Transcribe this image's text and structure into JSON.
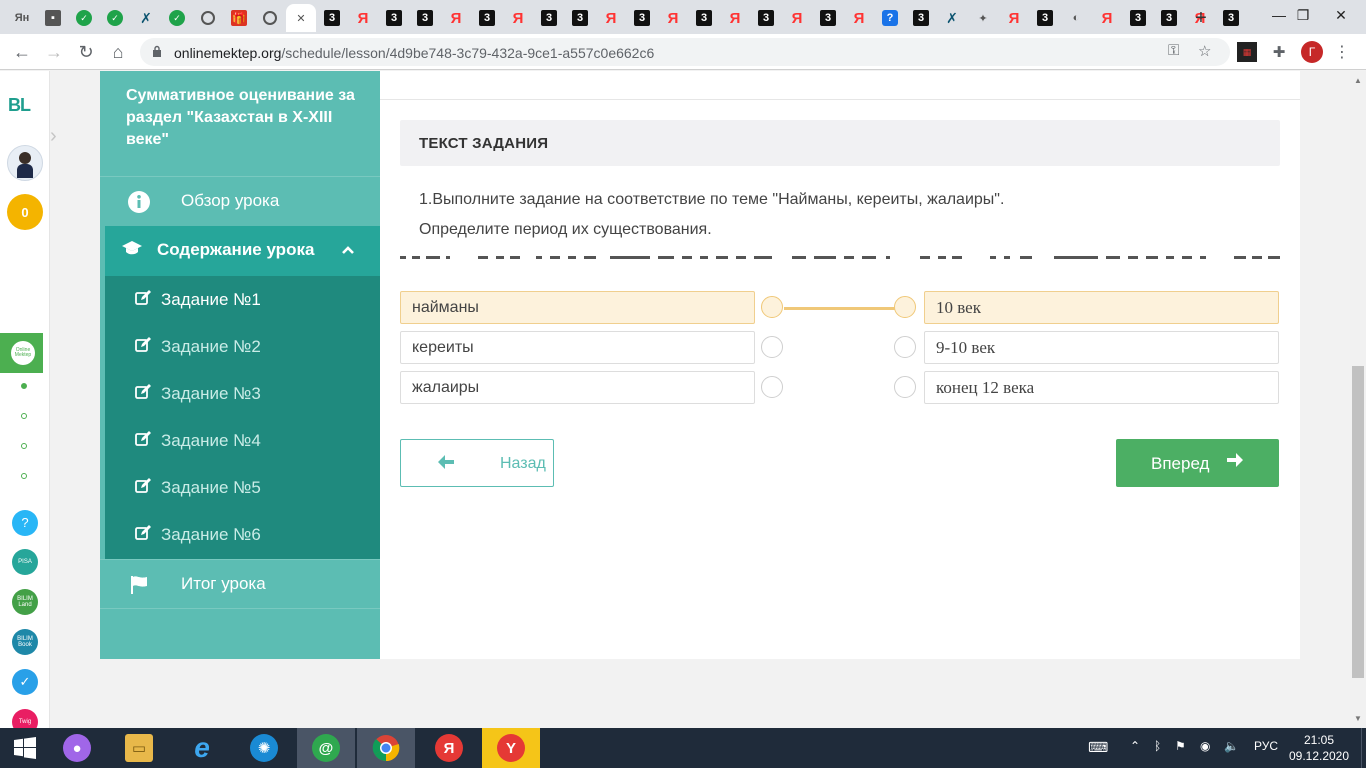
{
  "browser": {
    "tabs": [
      {
        "icon": "yandex-text-icon",
        "text": "Ян"
      },
      {
        "icon": "doc-icon",
        "text": "▪"
      },
      {
        "icon": "shield-icon",
        "text": "✓"
      },
      {
        "icon": "shield-icon",
        "text": "✓"
      },
      {
        "icon": "xx-icon",
        "text": "✗"
      },
      {
        "icon": "shield-icon",
        "text": "✓"
      },
      {
        "icon": "globe-icon",
        "text": ""
      },
      {
        "icon": "gift-icon",
        "text": "🎁"
      },
      {
        "icon": "globe-icon",
        "text": ""
      },
      {
        "icon": "close-icon",
        "text": "✕",
        "active": true
      },
      {
        "icon": "three-icon",
        "text": "3"
      },
      {
        "icon": "yandex-icon",
        "text": "Я"
      },
      {
        "icon": "three-icon",
        "text": "3"
      },
      {
        "icon": "three-icon",
        "text": "3"
      },
      {
        "icon": "yandex-icon",
        "text": "Я"
      },
      {
        "icon": "three-icon",
        "text": "3"
      },
      {
        "icon": "yandex-icon",
        "text": "Я"
      },
      {
        "icon": "three-icon",
        "text": "3"
      },
      {
        "icon": "three-icon",
        "text": "3"
      },
      {
        "icon": "yandex-icon",
        "text": "Я"
      },
      {
        "icon": "three-icon",
        "text": "3"
      },
      {
        "icon": "yandex-icon",
        "text": "Я"
      },
      {
        "icon": "three-icon",
        "text": "3"
      },
      {
        "icon": "yandex-icon",
        "text": "Я"
      },
      {
        "icon": "three-icon",
        "text": "3"
      },
      {
        "icon": "yandex-icon",
        "text": "Я"
      },
      {
        "icon": "three-icon",
        "text": "3"
      },
      {
        "icon": "yandex-icon",
        "text": "Я"
      },
      {
        "icon": "question-icon",
        "text": "?"
      },
      {
        "icon": "three-icon",
        "text": "3"
      },
      {
        "icon": "xx-icon",
        "text": "✗"
      },
      {
        "icon": "lightbulb-icon",
        "text": "✦"
      },
      {
        "icon": "yandex-icon",
        "text": "Я"
      },
      {
        "icon": "three-icon",
        "text": "3"
      },
      {
        "icon": "ball-icon",
        "text": "◐"
      },
      {
        "icon": "yandex-icon",
        "text": "Я"
      },
      {
        "icon": "three-icon",
        "text": "3"
      },
      {
        "icon": "three-icon",
        "text": "3"
      },
      {
        "icon": "yandex-icon",
        "text": "Я"
      },
      {
        "icon": "three-icon",
        "text": "3"
      }
    ],
    "new_tab": "+",
    "window_controls": {
      "minimize": "—",
      "maximize": "❐",
      "close": "✕"
    },
    "url_host": "onlinemektep.org",
    "url_path": "/schedule/lesson/4d9be748-3c79-432a-9ce1-a557c0e662c6",
    "profile_letter": "Г"
  },
  "rail": {
    "logo": "BL",
    "coins": "0",
    "active_app": "Online Mektep",
    "apps": [
      {
        "name": "help-icon",
        "text": "?",
        "color": "#29b6f6"
      },
      {
        "name": "pisa-icon",
        "text": "PISA",
        "color": "#26a69a"
      },
      {
        "name": "bilimland-icon",
        "text": "BILIM Land",
        "color": "#43a047"
      },
      {
        "name": "bilimbook-icon",
        "text": "BILIM Book",
        "color": "#1e88a8"
      },
      {
        "name": "test-icon",
        "text": "✓",
        "color": "#29a0e8"
      },
      {
        "name": "twig-icon",
        "text": "Twig",
        "color": "#e91e63"
      }
    ]
  },
  "sidebar": {
    "title": "Суммативное оценивание за раздел \"Казахстан в X-XIII веке\"",
    "overview": "Обзор урока",
    "content_header": "Содержание урока",
    "tasks": [
      "Задание №1",
      "Задание №2",
      "Задание №3",
      "Задание №4",
      "Задание №5",
      "Задание №6"
    ],
    "summary": "Итог урока"
  },
  "task": {
    "header": "ТЕКСТ ЗАДАНИЯ",
    "line1": "1.Выполните задание на соответствие по теме \"Найманы, кереиты, жалаиры\".",
    "line2": "Определите период их существования.",
    "left_items": [
      "найманы",
      "кереиты",
      "жалаиры"
    ],
    "right_items": [
      "10 век",
      "9-10 век",
      "конец 12 века"
    ],
    "matched": {
      "left": "найманы",
      "right": "10 век"
    },
    "accent": "#f0c878"
  },
  "nav": {
    "back": "Назад",
    "next": "Вперед"
  },
  "taskbar": {
    "lang": "РУС",
    "time": "21:05",
    "date": "09.12.2020"
  },
  "colors": {
    "sidebar": "#5cbdb3",
    "sidebar_active": "#26a69a",
    "sidebar_sub": "#1f8a7e",
    "next_button": "#4caf64"
  }
}
